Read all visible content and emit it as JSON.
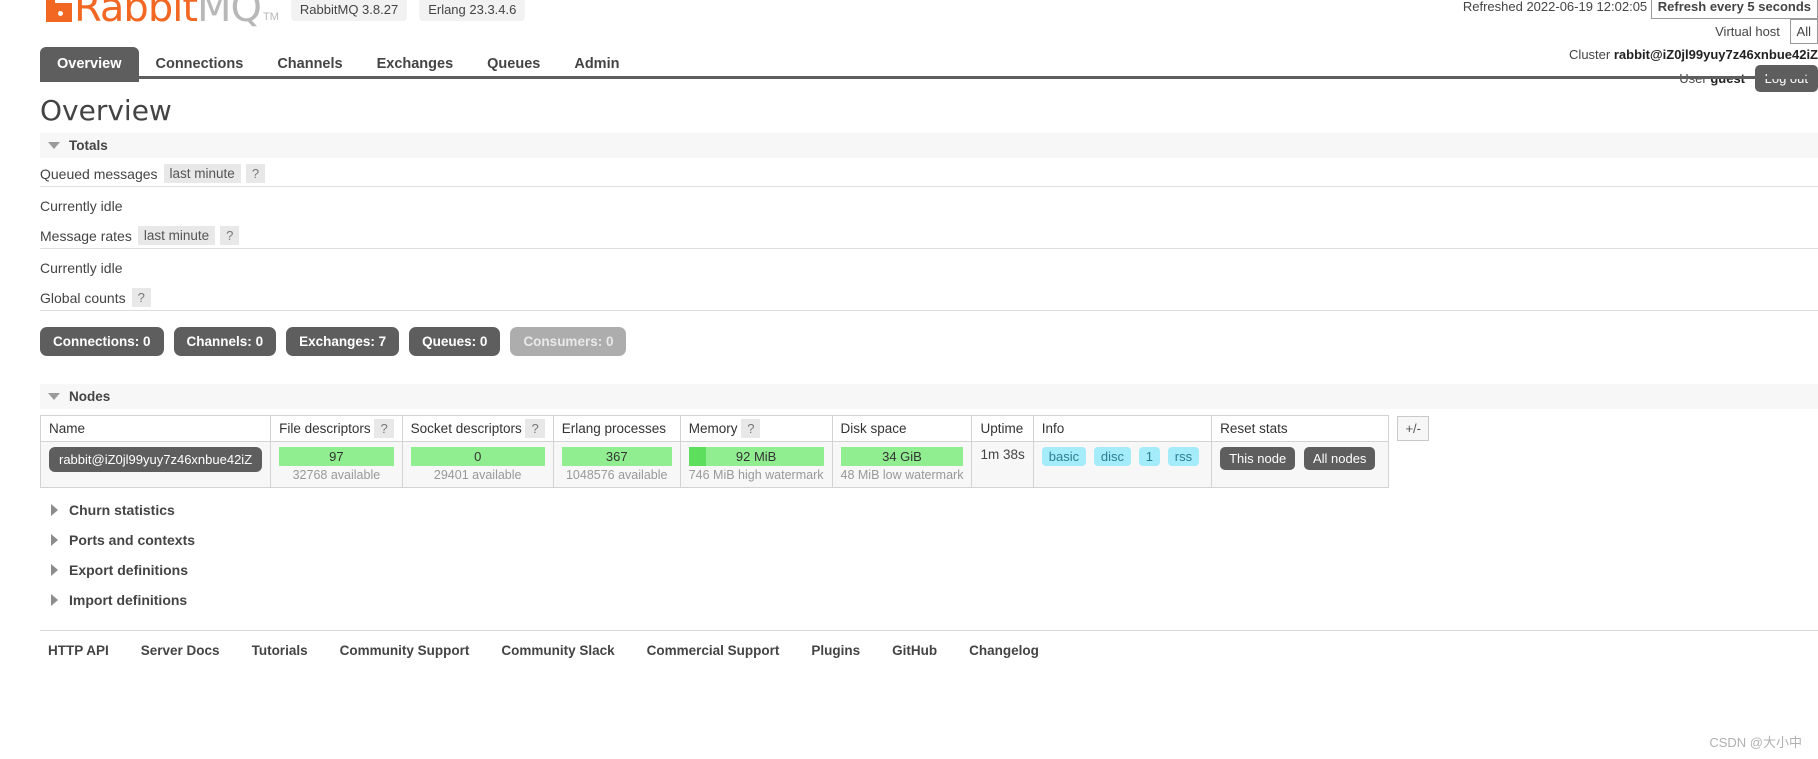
{
  "brand": {
    "rabbit": "Rabbit",
    "mq": "MQ",
    "tm": "TM",
    "server_version": "RabbitMQ 3.8.27",
    "erlang_version": "Erlang 23.3.4.6",
    "accent": "#f26722",
    "dark": "#5e5e5e"
  },
  "header_right": {
    "refreshed_label": "Refreshed 2022-06-19 12:02:05",
    "refresh_select": "Refresh every 5 seconds",
    "vhost_label": "Virtual host",
    "vhost_value": "All",
    "cluster_label": "Cluster",
    "cluster_value": "rabbit@iZ0jl99yuy7z46xnbue42iZ",
    "user_label": "User",
    "user_value": "guest",
    "logout_label": "Log out"
  },
  "tabs": [
    {
      "label": "Overview",
      "active": true
    },
    {
      "label": "Connections",
      "active": false
    },
    {
      "label": "Channels",
      "active": false
    },
    {
      "label": "Exchanges",
      "active": false
    },
    {
      "label": "Queues",
      "active": false
    },
    {
      "label": "Admin",
      "active": false
    }
  ],
  "page_title": "Overview",
  "totals": {
    "section_label": "Totals",
    "queued_messages_label": "Queued messages",
    "queued_messages_chip": "last minute",
    "queued_messages_help": "?",
    "queued_messages_idle": "Currently idle",
    "message_rates_label": "Message rates",
    "message_rates_chip": "last minute",
    "message_rates_help": "?",
    "message_rates_idle": "Currently idle",
    "global_counts_label": "Global counts",
    "global_counts_help": "?"
  },
  "global_counts": [
    {
      "label": "Connections:",
      "value": "0",
      "dim": false
    },
    {
      "label": "Channels:",
      "value": "0",
      "dim": false
    },
    {
      "label": "Exchanges:",
      "value": "7",
      "dim": false
    },
    {
      "label": "Queues:",
      "value": "0",
      "dim": false
    },
    {
      "label": "Consumers:",
      "value": "0",
      "dim": true
    }
  ],
  "nodes": {
    "section_label": "Nodes",
    "plus_minus": "+/-",
    "columns": {
      "name": "Name",
      "file_descriptors": "File descriptors",
      "file_descriptors_help": "?",
      "socket_descriptors": "Socket descriptors",
      "socket_descriptors_help": "?",
      "erlang_processes": "Erlang processes",
      "memory": "Memory",
      "memory_help": "?",
      "disk_space": "Disk space",
      "uptime": "Uptime",
      "info": "Info",
      "reset_stats": "Reset stats"
    },
    "row": {
      "name": "rabbit@iZ0jl99yuy7z46xnbue42iZ",
      "file_descriptors_value": "97",
      "file_descriptors_sub": "32768 available",
      "socket_descriptors_value": "0",
      "socket_descriptors_sub": "29401 available",
      "erlang_processes_value": "367",
      "erlang_processes_sub": "1048576 available",
      "memory_value": "92 MiB",
      "memory_sub": "746 MiB high watermark",
      "disk_space_value": "34 GiB",
      "disk_space_sub": "48 MiB low watermark",
      "uptime": "1m 38s",
      "info_tags": [
        "basic",
        "disc",
        "1",
        "rss"
      ],
      "reset_this_node": "This node",
      "reset_all_nodes": "All nodes"
    }
  },
  "collapsed_sections": [
    {
      "label": "Churn statistics"
    },
    {
      "label": "Ports and contexts"
    },
    {
      "label": "Export definitions"
    },
    {
      "label": "Import definitions"
    }
  ],
  "footer_links": [
    "HTTP API",
    "Server Docs",
    "Tutorials",
    "Community Support",
    "Community Slack",
    "Commercial Support",
    "Plugins",
    "GitHub",
    "Changelog"
  ],
  "watermark": "CSDN @大小中"
}
